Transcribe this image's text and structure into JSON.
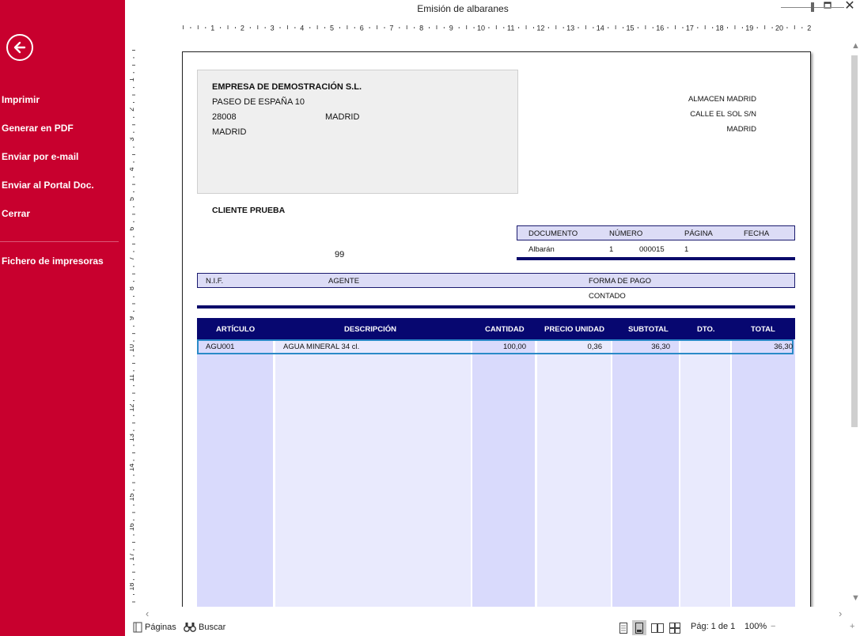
{
  "window": {
    "title": "Emisión de albaranes"
  },
  "sidebar": {
    "back_icon": "back-arrow-icon",
    "items": [
      {
        "label": "Imprimir"
      },
      {
        "label": "Generar en PDF"
      },
      {
        "label": "Enviar por e-mail"
      },
      {
        "label": "Enviar al Portal Doc."
      },
      {
        "label": "Cerrar"
      },
      {
        "label": "Fichero de impresoras"
      }
    ]
  },
  "ruler": {
    "h_numbers": [
      "1",
      "2",
      "3",
      "4",
      "5",
      "6",
      "7",
      "8",
      "9",
      "10",
      "11",
      "12",
      "13",
      "14",
      "15",
      "16",
      "17",
      "18",
      "19",
      "20",
      "2"
    ],
    "v_numbers": [
      "1",
      "2",
      "3",
      "4",
      "5",
      "6",
      "7",
      "8",
      "9",
      "10",
      "11",
      "12",
      "13",
      "14",
      "15",
      "16",
      "17",
      "18"
    ]
  },
  "document": {
    "company": {
      "name": "EMPRESA DE DEMOSTRACIÓN S.L.",
      "address": "PASEO DE ESPAÑA 10",
      "postal_code": "28008",
      "city": "MADRID",
      "province": "MADRID"
    },
    "warehouse": {
      "name": "ALMACEN MADRID",
      "address": "CALLE EL SOL S/N",
      "city": "MADRID"
    },
    "client": {
      "name": "CLIENTE PRUEBA",
      "code": "99"
    },
    "doc_info": {
      "headers": [
        "DOCUMENTO",
        "NÚMERO",
        "PÁGINA",
        "FECHA"
      ],
      "documento": "Albarán",
      "serie": "1",
      "numero": "000015",
      "pagina": "1",
      "fecha": ""
    },
    "payment": {
      "headers": [
        "N.I.F.",
        "AGENTE",
        "FORMA DE PAGO"
      ],
      "forma_pago": "CONTADO"
    },
    "table": {
      "headers": [
        "ARTÍCULO",
        "DESCRIPCIÓN",
        "CANTIDAD",
        "PRECIO UNIDAD",
        "SUBTOTAL",
        "DTO.",
        "TOTAL"
      ],
      "rows": [
        {
          "articulo": "AGU001",
          "descripcion": "AGUA MINERAL 34 cl.",
          "cantidad": "100,00",
          "precio": "0,36",
          "subtotal": "36,30",
          "dto": "",
          "total": "36,30"
        }
      ]
    }
  },
  "statusbar": {
    "pages_label": "Páginas",
    "search_label": "Buscar",
    "page_indicator": "Pág: 1 de 1",
    "zoom": "100%",
    "zoom_minus": "−",
    "zoom_plus": "+"
  },
  "colors": {
    "sidebar": "#c8002e",
    "table_header": "#070770",
    "column_alt": "#d9dafc",
    "column_light": "#e9eafd"
  }
}
